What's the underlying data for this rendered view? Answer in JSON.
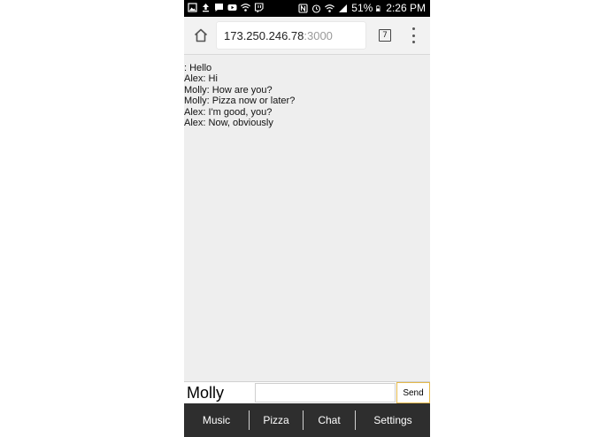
{
  "statusbar": {
    "battery": "51%",
    "time": "2:26 PM",
    "left_icons": [
      "image-icon",
      "upload-icon",
      "message-icon",
      "youtube-icon",
      "wifi-icon",
      "twitch-icon"
    ],
    "right_icons": [
      "nfc-icon",
      "alarm-icon",
      "wifi-signal-icon",
      "cell-signal-icon",
      "battery-icon"
    ]
  },
  "browser": {
    "url_host": "173.250.246.78",
    "url_port": ":3000",
    "tab_count": "7"
  },
  "chat": {
    "messages": [
      ": Hello",
      "Alex: Hi",
      "Molly: How are you?",
      "Molly: Pizza now or later?",
      "Alex: I'm good, you?",
      "Alex: Now, obviously"
    ]
  },
  "composer": {
    "name": "Molly",
    "input_value": "",
    "send_label": "Send"
  },
  "nav": {
    "items": [
      "Music",
      "Pizza",
      "Chat",
      "Settings"
    ]
  },
  "colors": {
    "page_bg": "#eeeeee",
    "statusbar_bg": "#000000",
    "nav_bg": "#2e2e2e",
    "send_border": "#e5b94a"
  }
}
